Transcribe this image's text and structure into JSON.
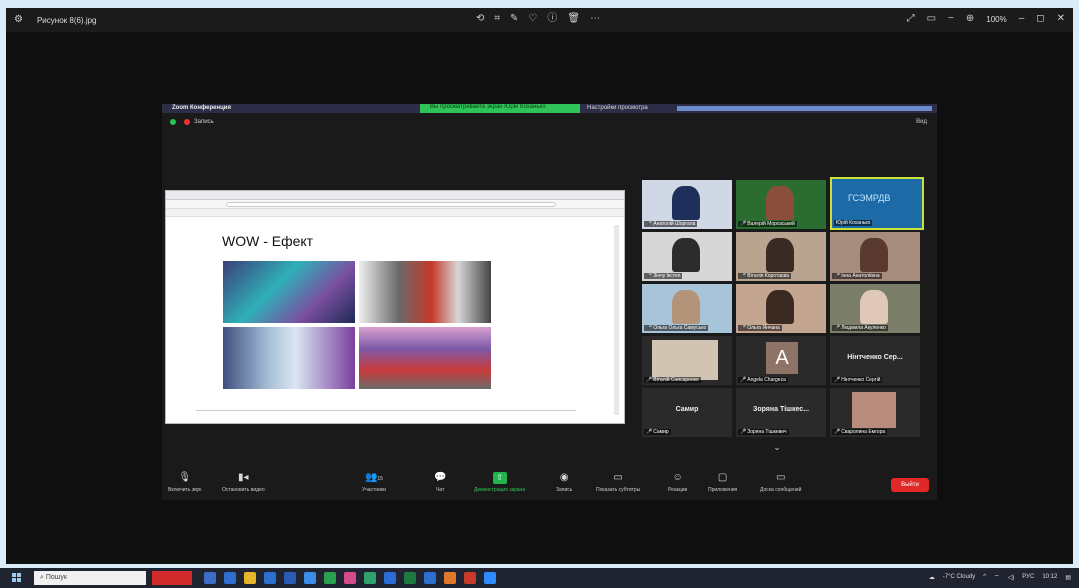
{
  "viewer": {
    "filename": "Рисунок 8(6).jpg",
    "zoom_level": "100%"
  },
  "zoom": {
    "title": "Zoom Конференция",
    "banner": "Вы просматриваете экран Юрій Коханько",
    "settings": "Настройки просмотра",
    "recording": "Запись",
    "view": "Вид"
  },
  "slide": {
    "title": "WOW - Ефект"
  },
  "gallery": [
    {
      "name": "Анатолій Шоргала"
    },
    {
      "name": "Валерій Морозський"
    },
    {
      "name": "Юрій Коханько",
      "logo": "ГСЭМРДВ"
    },
    {
      "name": "Зінчу Ікстеп"
    },
    {
      "name": "Віталія Коротаєва"
    },
    {
      "name": "Інна Анатоліївна"
    },
    {
      "name": "Ольга Ольга Самусько"
    },
    {
      "name": "Ольга Янчана"
    },
    {
      "name": "Людмила Акуленко"
    },
    {
      "name": "Віталій Снисаренко"
    },
    {
      "name": "Angela Chargeza",
      "initial": "A"
    },
    {
      "name": "Нінтченко Сергій",
      "big": "Нінтченко Сер..."
    },
    {
      "name": "Самир",
      "big": "Самир"
    },
    {
      "name": "Зоряна Тішкевич",
      "big": "Зоряна Тішкес..."
    },
    {
      "name": "Сваролина Емгора"
    }
  ],
  "toolbar": {
    "mute": "Включить звук",
    "video": "Остановить видео",
    "participants": "Участники",
    "participants_count": "15",
    "chat": "Чат",
    "share": "Демонстрация экрана",
    "record": "Запись",
    "captions": "Показать субтитры",
    "reactions": "Реакции",
    "apps": "Приложения",
    "whiteboard": "Доска сообщений",
    "leave": "Выйти"
  },
  "taskbar": {
    "search": "Пошук",
    "weather": "-7°C Cloudy",
    "lang": "РУС",
    "time": "10:12"
  }
}
